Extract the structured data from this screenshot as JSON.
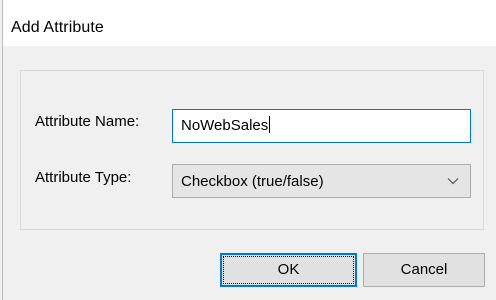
{
  "dialog": {
    "title": "Add Attribute"
  },
  "form": {
    "name_label": "Attribute Name:",
    "name_value": "NoWebSales",
    "type_label": "Attribute Type:",
    "type_value": "Checkbox (true/false)",
    "type_icon": "chevron-down-icon"
  },
  "buttons": {
    "ok_label": "OK",
    "cancel_label": "Cancel"
  },
  "colors": {
    "accent": "#0078d7",
    "dialog_body": "#f0f0f0",
    "button_face": "#e1e1e1"
  }
}
